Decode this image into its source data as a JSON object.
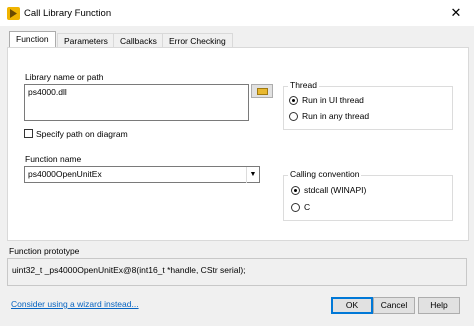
{
  "window": {
    "title": "Call Library Function",
    "close_glyph": "✕"
  },
  "tabs": [
    {
      "label": "Function",
      "active": true
    },
    {
      "label": "Parameters",
      "active": false
    },
    {
      "label": "Callbacks",
      "active": false
    },
    {
      "label": "Error Checking",
      "active": false
    }
  ],
  "library": {
    "label": "Library name or path",
    "value": "ps4000.dll",
    "browse_icon": "folder-icon",
    "specify_path_label": "Specify path on diagram",
    "specify_path_checked": false
  },
  "function": {
    "label": "Function name",
    "value": "ps4000OpenUnitEx"
  },
  "thread": {
    "title": "Thread",
    "options": [
      {
        "label": "Run in UI thread",
        "selected": true
      },
      {
        "label": "Run in any thread",
        "selected": false
      }
    ]
  },
  "calling_convention": {
    "title": "Calling convention",
    "options": [
      {
        "label": "stdcall (WINAPI)",
        "selected": true
      },
      {
        "label": "C",
        "selected": false
      }
    ]
  },
  "prototype": {
    "label": "Function prototype",
    "text": "uint32_t _ps4000OpenUnitEx@8(int16_t *handle, CStr serial);"
  },
  "footer": {
    "wizard_link": "Consider using a wizard instead...",
    "ok": "OK",
    "cancel": "Cancel",
    "help": "Help"
  },
  "colors": {
    "accent": "#0078d7",
    "link": "#0563c1",
    "dialog_bg": "#f0f0f0"
  }
}
